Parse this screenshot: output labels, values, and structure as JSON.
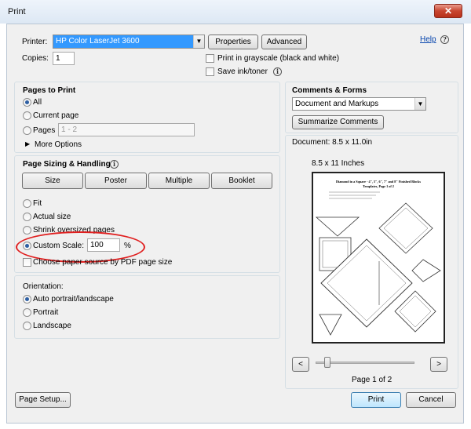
{
  "window": {
    "title": "Print",
    "close_glyph": "✕"
  },
  "printer": {
    "label": "Printer:",
    "selected": "HP Color LaserJet 3600",
    "properties": "Properties",
    "advanced": "Advanced",
    "help": "Help",
    "copies_label": "Copies:",
    "copies_value": "1",
    "grayscale": "Print in grayscale (black and white)",
    "save_ink": "Save ink/toner"
  },
  "pages_to_print": {
    "heading": "Pages to Print",
    "all": "All",
    "current": "Current page",
    "pages": "Pages",
    "pages_placeholder": "1 - 2",
    "more_options": "More Options"
  },
  "sizing": {
    "heading": "Page Sizing & Handling",
    "buttons": [
      "Size",
      "Poster",
      "Multiple",
      "Booklet"
    ],
    "fit": "Fit",
    "actual": "Actual size",
    "shrink": "Shrink oversized pages",
    "custom": "Custom Scale:",
    "custom_value": "100",
    "percent": "%",
    "paper_source": "Choose paper source by PDF page size"
  },
  "orientation": {
    "heading": "Orientation:",
    "auto": "Auto portrait/landscape",
    "portrait": "Portrait",
    "landscape": "Landscape"
  },
  "comments": {
    "heading": "Comments & Forms",
    "selected": "Document and Markups",
    "summarize": "Summarize Comments"
  },
  "document": {
    "size": "Document: 8.5 x 11.0in",
    "paper": "8.5 x 11 Inches",
    "page_title": "Diamond in a Square - 4\", 5\", 6\", 7\" and 8\" Finished Blocks",
    "page_subtitle": "Templates, Page 1 of 2",
    "page_indicator": "Page 1 of 2"
  },
  "footer": {
    "page_setup": "Page Setup...",
    "print": "Print",
    "cancel": "Cancel"
  },
  "icons": {
    "info": "info-icon",
    "dropdown": "dropdown-arrow-icon",
    "prev": "prev-page-icon",
    "next": "next-page-icon"
  },
  "colors": {
    "selection": "#3399ff",
    "annotation": "#e02020"
  }
}
